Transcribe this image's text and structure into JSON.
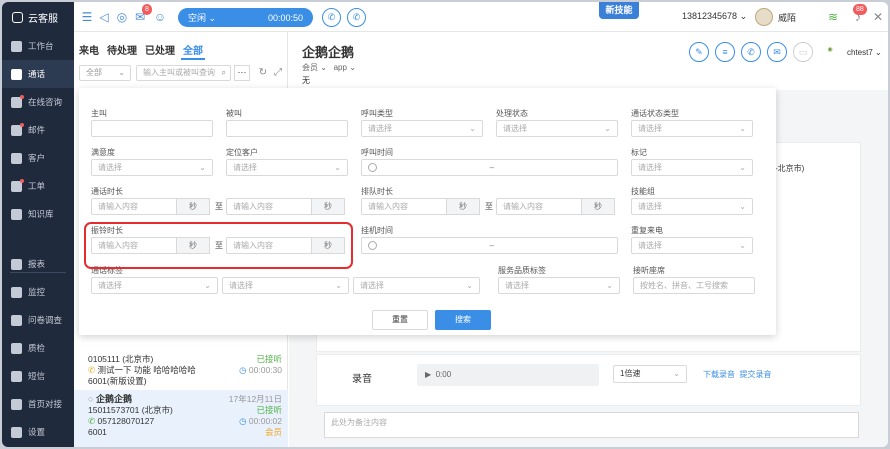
{
  "app": {
    "name": "云客服"
  },
  "topbar": {
    "notif_count": "8",
    "status_label": "空闲",
    "timer": "00:00:50",
    "new_feature": "新技能",
    "phone": "13812345678",
    "user_name": "威陌",
    "alert_count": "88"
  },
  "sidebar": {
    "items": [
      {
        "label": "工作台",
        "icon": "home-icon"
      },
      {
        "label": "通话",
        "icon": "phone-icon"
      },
      {
        "label": "在线咨询",
        "icon": "chat-icon"
      },
      {
        "label": "邮件",
        "icon": "mail-icon"
      },
      {
        "label": "客户",
        "icon": "user-icon"
      },
      {
        "label": "工单",
        "icon": "ticket-icon"
      },
      {
        "label": "知识库",
        "icon": "book-icon"
      },
      {
        "label": "报表",
        "icon": "report-icon"
      },
      {
        "label": "监控",
        "icon": "monitor-icon"
      },
      {
        "label": "问卷调查",
        "icon": "survey-icon"
      },
      {
        "label": "质检",
        "icon": "shield-icon"
      },
      {
        "label": "短信",
        "icon": "sms-icon"
      },
      {
        "label": "首页对接",
        "icon": "link-icon"
      },
      {
        "label": "设置",
        "icon": "gear-icon"
      }
    ]
  },
  "list": {
    "tabs": [
      "来电",
      "待处理",
      "已处理",
      "全部"
    ],
    "filter_select": "全部",
    "search_placeholder": "输入主叫或被叫查询",
    "items": [
      {
        "line1": "0105111 (北京市)",
        "status": "已接听",
        "desc": "测试一下 功能 哈哈哈哈哈",
        "duration": "00:00:30",
        "line3": "6001(新版设置)"
      },
      {
        "name": "企鹅企鹅",
        "date": "17年12月11日",
        "line1": "15011573701 (北京市)",
        "status": "已接听",
        "desc": "057128070127",
        "duration": "00:00:02",
        "line3": "6001",
        "tag": "会员"
      }
    ]
  },
  "detail": {
    "title": "企鹅企鹅",
    "tag1": "会员",
    "tag2": "app",
    "none": "无",
    "current_user": "chtest7",
    "bg_city": "-北京市)",
    "rec_label": "录音",
    "player_time": "0:00",
    "speed": "1倍速",
    "download": "下载录音",
    "submit_rec": "提交录音",
    "note_placeholder": "此处为备注内容"
  },
  "filter": {
    "labels": {
      "caller": "主叫",
      "callee": "被叫",
      "call_type": "呼叫类型",
      "handle_status": "处理状态",
      "call_status_type": "通话状态类型",
      "satisfaction": "满意度",
      "locate_customer": "定位客户",
      "call_time": "呼叫时间",
      "mark": "标记",
      "talk_duration": "通话时长",
      "queue_duration": "排队时长",
      "skill_group": "技能组",
      "ring_duration": "振铃时长",
      "hangup_time": "挂机时间",
      "repeat_call": "重复来电",
      "call_tag": "通话标签",
      "service_tag": "服务品质标签",
      "listen_seat": "接听座席"
    },
    "select_placeholder": "请选择",
    "input_placeholder": "请输入内容",
    "unit_sec": "秒",
    "to": "至",
    "dash": "–",
    "seat_placeholder": "按姓名、拼音、工号搜索",
    "reset": "重置",
    "search": "搜索"
  }
}
